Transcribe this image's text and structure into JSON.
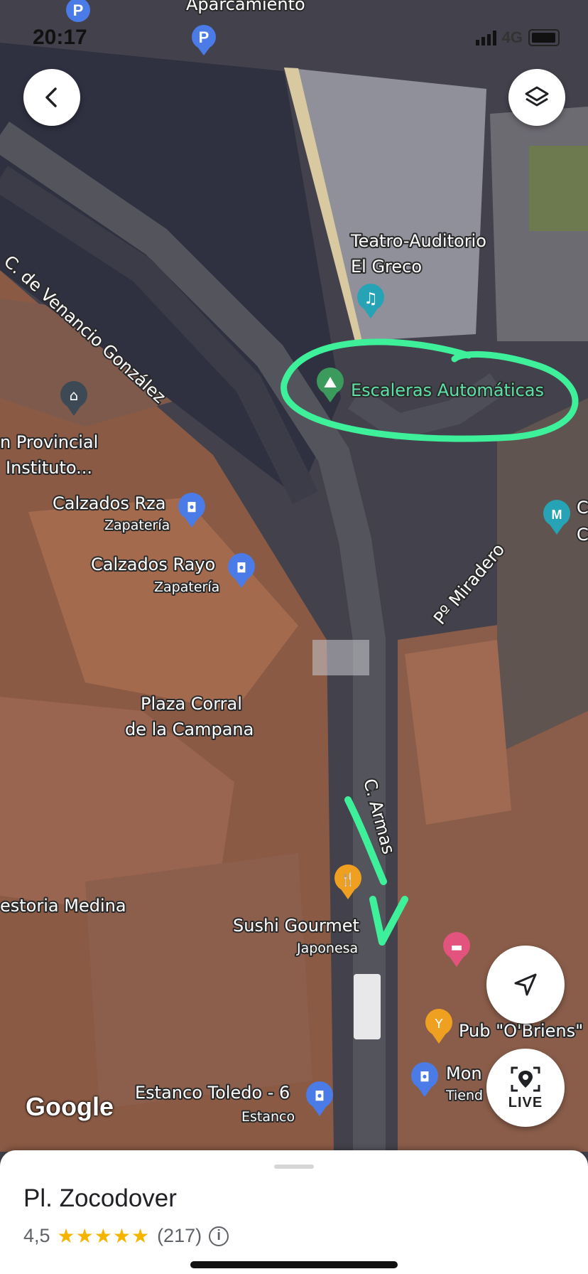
{
  "status_bar": {
    "time": "20:17",
    "network": "4G"
  },
  "map": {
    "labels": {
      "aparcamiento": "Aparcamiento",
      "teatro_line1": "Teatro-Auditorio",
      "teatro_line2": "El Greco",
      "escaleras": "Escaleras Automáticas",
      "street_venancio": "C. de Venancio González",
      "provincial_line1": "n Provincial",
      "provincial_line2": "Instituto...",
      "calzados_rza": "Calzados Rza",
      "calzados_rza_cat": "Zapatería",
      "calzados_rayo": "Calzados Rayo",
      "calzados_rayo_cat": "Zapatería",
      "street_miradero": "Pº Miradero",
      "plaza_line1": "Plaza Corral",
      "plaza_line2": "de la Campana",
      "street_armas": "C. Armas",
      "restoria": "estoria Medina",
      "sushi": "Sushi Gourmet",
      "sushi_cat": "Japonesa",
      "pub": "Pub \"O'Briens\"",
      "mon": "Mon",
      "tiend": "Tiend",
      "estanco": "Estanco Toledo - 6",
      "estanco_cat": "Estanco",
      "edge_c1": "C",
      "edge_c2": "C",
      "parking_letter": "P"
    },
    "google_logo": "Google"
  },
  "controls": {
    "live_label": "LIVE"
  },
  "place_sheet": {
    "name": "Pl. Zocodover",
    "rating": "4,5",
    "stars": "★★★★★",
    "review_count": "(217)",
    "info_symbol": "i"
  },
  "colors": {
    "annotation": "#3ef09a",
    "pin_green": "#3a9b5c",
    "pin_blue": "#4a7be6",
    "pin_teal": "#27a3b6",
    "pin_orange": "#f0a020",
    "pin_pink": "#e2537d"
  }
}
